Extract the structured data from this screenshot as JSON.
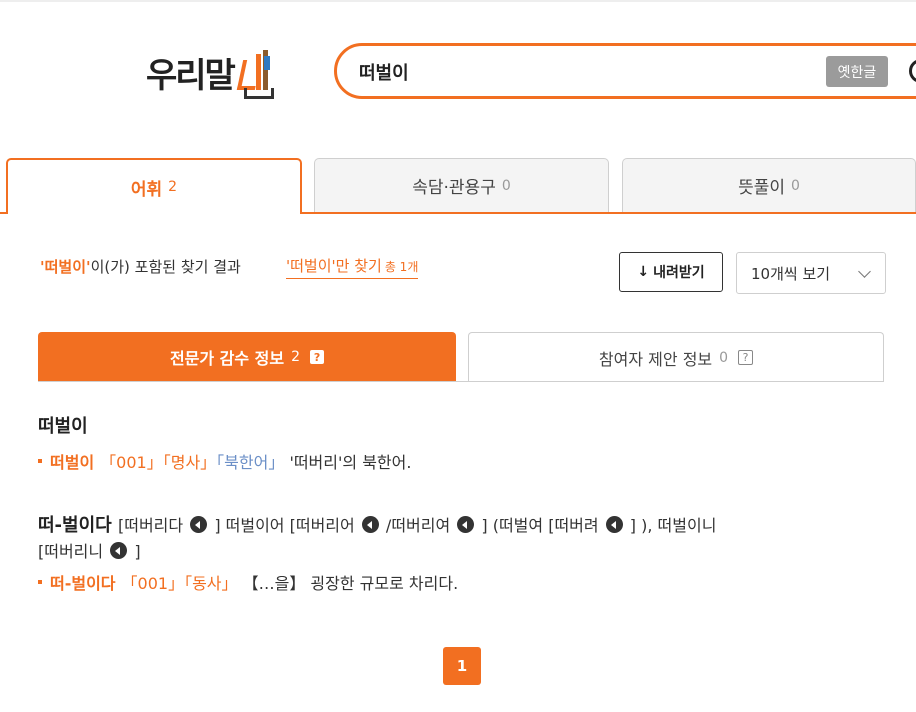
{
  "logo": {
    "text": "우리말"
  },
  "search": {
    "value": "떠벌이",
    "oldhangul_label": "옛한글"
  },
  "tabs": [
    {
      "label": "어휘",
      "count": "2"
    },
    {
      "label": "속담·관용구",
      "count": "0"
    },
    {
      "label": "뜻풀이",
      "count": "0"
    }
  ],
  "summary": {
    "query_quoted": "'떠벌이'",
    "text": "이(가) 포함된 찾기 결과",
    "only_link": "'떠벌이'만 찾기",
    "only_total": "총 1개",
    "download_label": "내려받기",
    "perpage_label": "10개씩 보기"
  },
  "subtabs": {
    "expert_label": "전문가 감수 정보",
    "expert_count": "2",
    "user_label": "참여자 제안 정보",
    "user_count": "0",
    "help_glyph": "?"
  },
  "entries": [
    {
      "headword": "떠벌이",
      "sense_word": "떠벌이",
      "tag_num": "「001」",
      "tag_pos": "「명사」",
      "tag_region": "「북한어」",
      "definition": "'떠버리'의 북한어."
    },
    {
      "headword": "떠-벌이다",
      "p1": "[떠버리다",
      "p2": "] 떠벌이어 [떠버리어",
      "p3": "/떠버리여",
      "p4": "] (떠벌여 [떠버려",
      "p5": "] ), 떠벌이니",
      "p6": "[떠버리니",
      "p7": "]",
      "sense_word": "떠-벌이다",
      "tag_num": "「001」",
      "tag_pos": "「동사」",
      "definition": "【…을】 굉장한 규모로 차리다."
    }
  ],
  "pagination": {
    "current": "1"
  },
  "colors": {
    "accent": "#f26f21",
    "blue_tag": "#6b8fc7"
  }
}
